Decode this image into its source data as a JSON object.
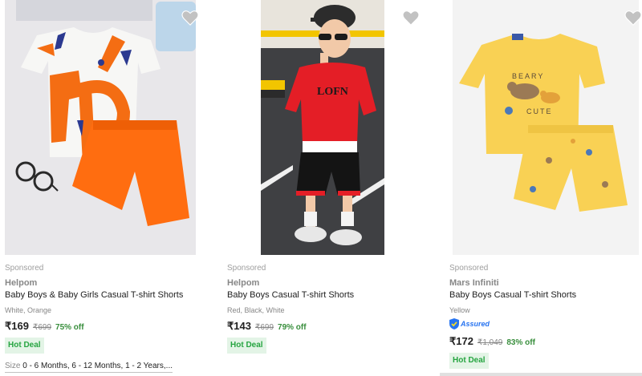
{
  "products": [
    {
      "sponsored": "Sponsored",
      "brand": "Helpom",
      "title": "Baby Boys & Baby Girls Casual T-shirt Shorts",
      "variant": "White, Orange",
      "price": "₹169",
      "mrp": "₹699",
      "discount": "75% off",
      "badge": "Hot Deal",
      "size_label": "Size",
      "size_values": "0 - 6 Months, 6 - 12 Months, 1 - 2 Years,...",
      "image_icon": "product-photo-white-orange-tshirt-shorts",
      "wishlist_icon": "heart-icon"
    },
    {
      "sponsored": "Sponsored",
      "brand": "Helpom",
      "title": "Baby Boys Casual T-shirt Shorts",
      "variant": "Red, Black, White",
      "price": "₹143",
      "mrp": "₹699",
      "discount": "79% off",
      "badge": "Hot Deal",
      "image_icon": "product-photo-boy-red-tshirt-black-shorts",
      "image_text": "LOFN",
      "wishlist_icon": "heart-icon"
    },
    {
      "sponsored": "Sponsored",
      "brand": "Mars Infiniti",
      "title": "Baby Boys Casual T-shirt Shorts",
      "variant": "Yellow",
      "assured_label": "Assured",
      "price": "₹172",
      "mrp": "₹1,049",
      "discount": "83% off",
      "badge": "Hot Deal",
      "image_icon": "product-photo-yellow-bear-tshirt-shorts",
      "image_text_top": "BEARY",
      "image_text_bottom": "CUTE",
      "wishlist_icon": "heart-icon"
    }
  ],
  "colors": {
    "discount_green": "#388e3c",
    "hot_deal_bg": "#e3f4e6",
    "hot_deal_text": "#26a541",
    "assured_blue": "#2874f0",
    "wishlist_grey": "#c2c2c2"
  }
}
